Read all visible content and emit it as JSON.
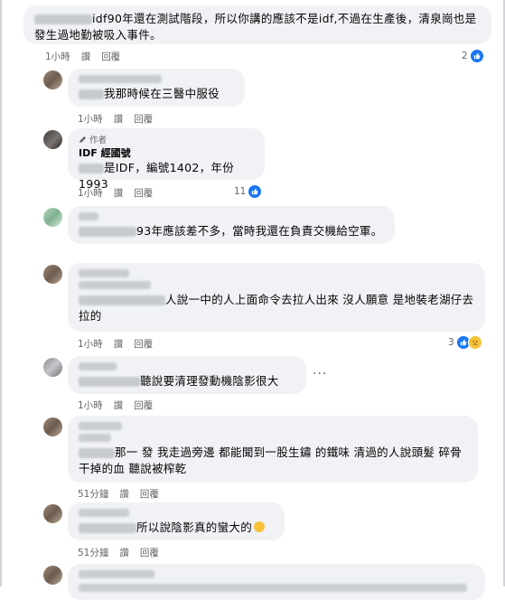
{
  "comments": [
    {
      "text": "idf90年還在測試階段，所以你講的應該不是idf,不過在生產後，清泉崗也是發生過地勤被吸入事件。",
      "time": "1小時",
      "reply": "讚",
      "respond": "回覆",
      "reaction_count": "2"
    },
    {
      "text": "我那時候在三醫中服役",
      "time": "1小時",
      "reply": "讚",
      "respond": "回覆"
    },
    {
      "author_tag": "作者",
      "author_name": "IDF 經國號",
      "text": "是IDF，編號1402，年份1993",
      "time": "1小時",
      "reply": "讚",
      "respond": "回覆",
      "reaction_count": "11"
    },
    {
      "text": "93年應該差不多，當時我還在負責交機給空軍。",
      "time": "1小時",
      "reply": "讚",
      "respond": "回覆"
    },
    {
      "text": "人說一中的人上面命令去拉人出來 沒人願意 是地裝老湖仔去拉的",
      "time": "1小時",
      "reply": "讚",
      "respond": "回覆",
      "reaction_count": "3"
    },
    {
      "text": "聽說要清理發動機陰影很大",
      "time": "1小時",
      "reply": "讚",
      "respond": "回覆",
      "more": "···"
    },
    {
      "text": "那一 發 我走過旁邊 都能聞到一股生鏽 的鐵味 清過的人說頭髮 碎骨 干掉的血 聽說被榨乾",
      "time": "51分鐘",
      "reply": "讚",
      "respond": "回覆"
    },
    {
      "text": "所以說陰影真的蠻大的",
      "time": "51分鐘",
      "reply": "讚",
      "respond": "回覆"
    }
  ],
  "colors": {
    "bubble": "#f0f2f5",
    "like": "#1877f2",
    "meta": "#65676b"
  },
  "icons": [
    "like-icon",
    "sad-icon",
    "pencil-icon",
    "sweat-smile-icon",
    "more-icon"
  ]
}
